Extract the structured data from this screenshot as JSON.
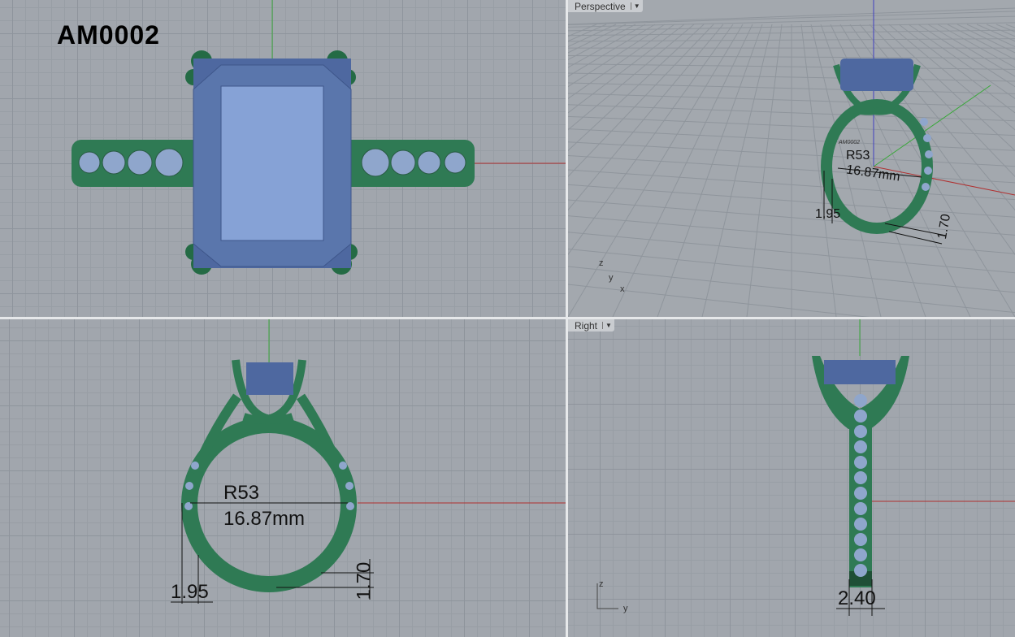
{
  "viewports": {
    "top": {
      "title": "AM0002"
    },
    "perspective": {
      "label": "Perspective",
      "engraving": "AM0002",
      "radius": "R53",
      "diameter": "16.87mm",
      "width": "1.95",
      "height": "1.70",
      "axes": {
        "z": "z",
        "y": "y",
        "x": "x"
      }
    },
    "front": {
      "radius": "R53",
      "diameter": "16.87mm",
      "width": "1.95",
      "height": "1.70"
    },
    "right": {
      "label": "Right",
      "thickness": "2.40",
      "axes": {
        "z": "z",
        "y": "y"
      }
    }
  },
  "colors": {
    "metal": "#2f7a54",
    "stone": "#5b77a8",
    "x_axis": "#b03030",
    "y_axis": "#3aa83a",
    "z_axis": "#4040c0",
    "background": "#a1a6ad"
  }
}
